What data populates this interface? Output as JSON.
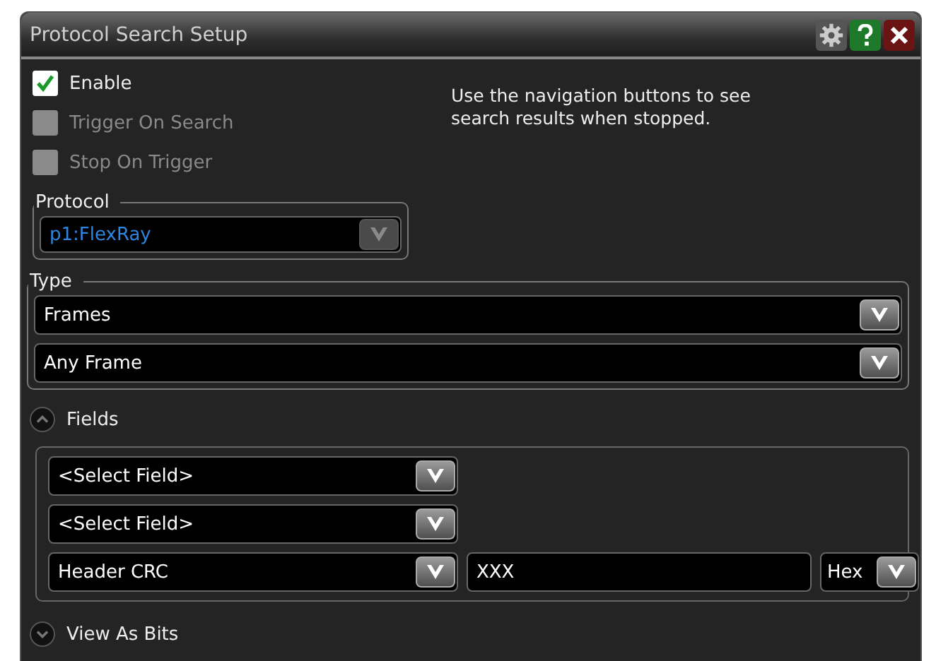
{
  "window": {
    "title": "Protocol Search Setup"
  },
  "options": [
    {
      "label": "Enable",
      "checked": true,
      "disabled": false
    },
    {
      "label": "Trigger On Search",
      "checked": false,
      "disabled": true
    },
    {
      "label": "Stop On Trigger",
      "checked": false,
      "disabled": true
    }
  ],
  "note": "Use the navigation buttons to see search results when stopped.",
  "protocol": {
    "label": "Protocol",
    "value": "p1:FlexRay",
    "disabled": true
  },
  "type": {
    "label": "Type",
    "dropdowns": [
      {
        "value": "Frames"
      },
      {
        "value": "Any Frame"
      }
    ]
  },
  "fields_section": {
    "label": "Fields",
    "expanded": true
  },
  "fields": [
    {
      "field": "<Select Field>"
    },
    {
      "field": "<Select Field>"
    },
    {
      "field": "Header CRC",
      "value": "XXX",
      "format": "Hex"
    }
  ],
  "bits_section": {
    "label": "View As Bits",
    "expanded": false
  }
}
